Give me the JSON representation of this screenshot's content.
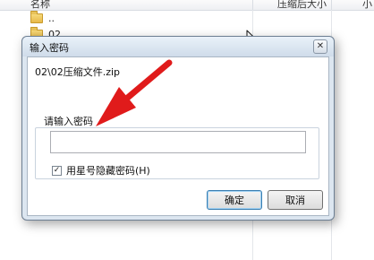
{
  "background": {
    "columns": {
      "name": "名称",
      "compressed_size": "压缩后大小",
      "extra": "小"
    },
    "rows": [
      {
        "label": ".."
      },
      {
        "label": "02"
      }
    ]
  },
  "dialog": {
    "title": "输入密码",
    "close_glyph": "✕",
    "file_path": "02\\02压缩文件.zip",
    "group_label": "请输入密码",
    "password_value": "",
    "checkbox": {
      "label": "用星号隐藏密码(H)",
      "checked": true,
      "mark": "✓"
    },
    "ok_label": "确定",
    "cancel_label": "取消"
  },
  "colors": {
    "arrow": "#e01b1b",
    "dialog_frame": "#dce6f0",
    "ok_border": "#3c7fb1"
  },
  "icons": {
    "folder": "folder-icon",
    "close": "close-icon",
    "cursor": "mouse-cursor-icon",
    "arrow": "red-arrow-annotation"
  }
}
